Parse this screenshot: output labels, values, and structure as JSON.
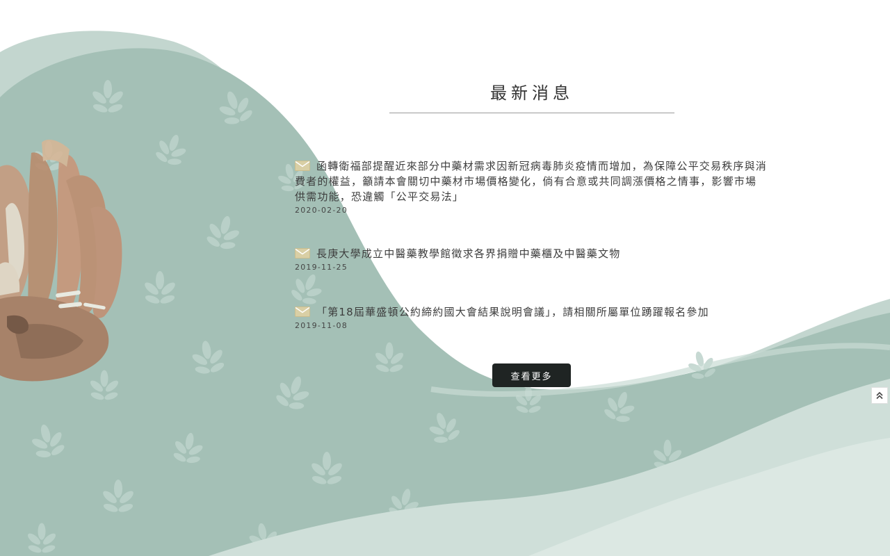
{
  "section": {
    "title": "最新消息"
  },
  "news": [
    {
      "headline": "函轉衛福部提醒近來部分中藥材需求因新冠病毒肺炎疫情而增加，為保障公平交易秩序與消費者的權益，籲請本會關切中藥材市場價格變化，倘有合意或共同調漲價格之情事，影響市場供需功能，恐違觸「公平交易法」",
      "date": "2020-02-20",
      "icon": "mail-icon"
    },
    {
      "headline": "長庚大學成立中醫藥教學館徵求各界捐贈中藥櫃及中醫藥文物",
      "date": "2019-11-25",
      "icon": "mail-icon"
    },
    {
      "headline": "「第18屆華盛頓公約締約國大會結果說明會議」，請相關所屬單位踴躍報名參加",
      "date": "2019-11-08",
      "icon": "mail-icon"
    }
  ],
  "more_button": {
    "label": "查看更多"
  },
  "back_to_top": {
    "icon": "double-chevron-up-icon"
  },
  "colors": {
    "wave_dark": "#a4c0b6",
    "wave_mid": "#b7cfc6",
    "wave_light": "#d3e2dc",
    "leaf": "#c6d9d2",
    "button_bg": "#1f2423",
    "mail_icon": "#d9cfa5"
  }
}
